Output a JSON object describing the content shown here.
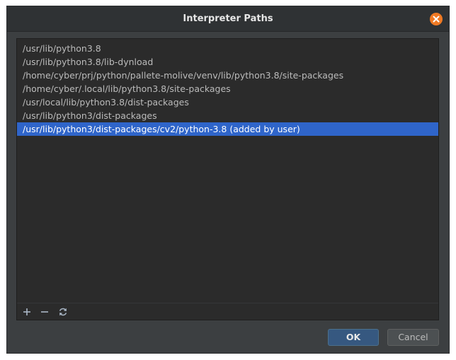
{
  "dialog": {
    "title": "Interpreter Paths"
  },
  "paths": [
    "/usr/lib/python3.8",
    "/usr/lib/python3.8/lib-dynload",
    "/home/cyber/prj/python/pallete-molive/venv/lib/python3.8/site-packages",
    "/home/cyber/.local/lib/python3.8/site-packages",
    "/usr/local/lib/python3.8/dist-packages",
    "/usr/lib/python3/dist-packages",
    "/usr/lib/python3/dist-packages/cv2/python-3.8  (added by user)"
  ],
  "selected_index": 6,
  "toolbar": {
    "add_icon": "plus-icon",
    "remove_icon": "minus-icon",
    "reload_icon": "reload-icon"
  },
  "buttons": {
    "ok_label": "OK",
    "cancel_label": "Cancel"
  },
  "colors": {
    "accent_close": "#f07a24",
    "selection": "#2f65ca"
  }
}
